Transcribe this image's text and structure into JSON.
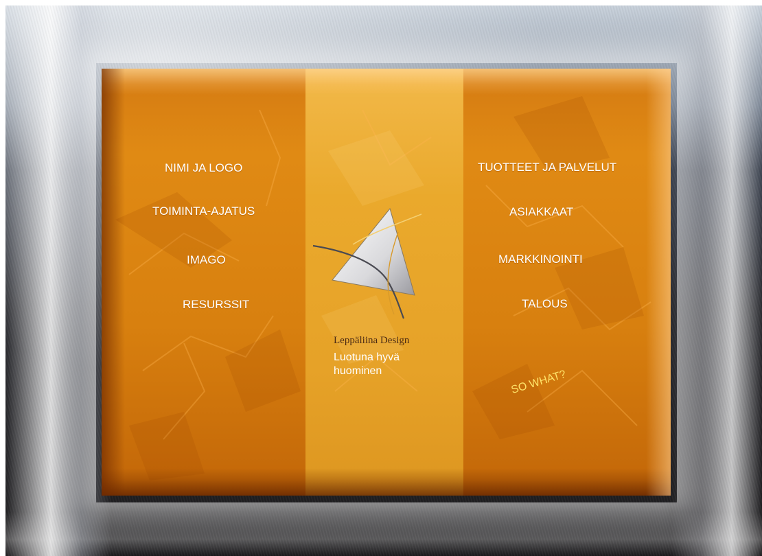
{
  "left_menu": [
    {
      "label": "NIMI JA LOGO"
    },
    {
      "label": "TOIMINTA-AJATUS"
    },
    {
      "label": "IMAGO"
    },
    {
      "label": "RESURSSIT"
    }
  ],
  "right_menu": [
    {
      "label": "TUOTTEET JA PALVELUT"
    },
    {
      "label": "ASIAKKAAT"
    },
    {
      "label": "MARKKINOINTI"
    },
    {
      "label": "TALOUS"
    }
  ],
  "brand": {
    "name": "Leppäliina Design",
    "tagline_line1": "Luotuna hyvä",
    "tagline_line2": "huominen",
    "logo_icon": "triangle-logo-icon"
  },
  "extra_link": {
    "label": "SO WHAT?"
  },
  "colors": {
    "board_orange": "#d8800f",
    "center_band": "#eaa92c",
    "menu_text": "#ffffff",
    "accent_link": "#ffe46a",
    "brand_text": "#4a2a14"
  }
}
